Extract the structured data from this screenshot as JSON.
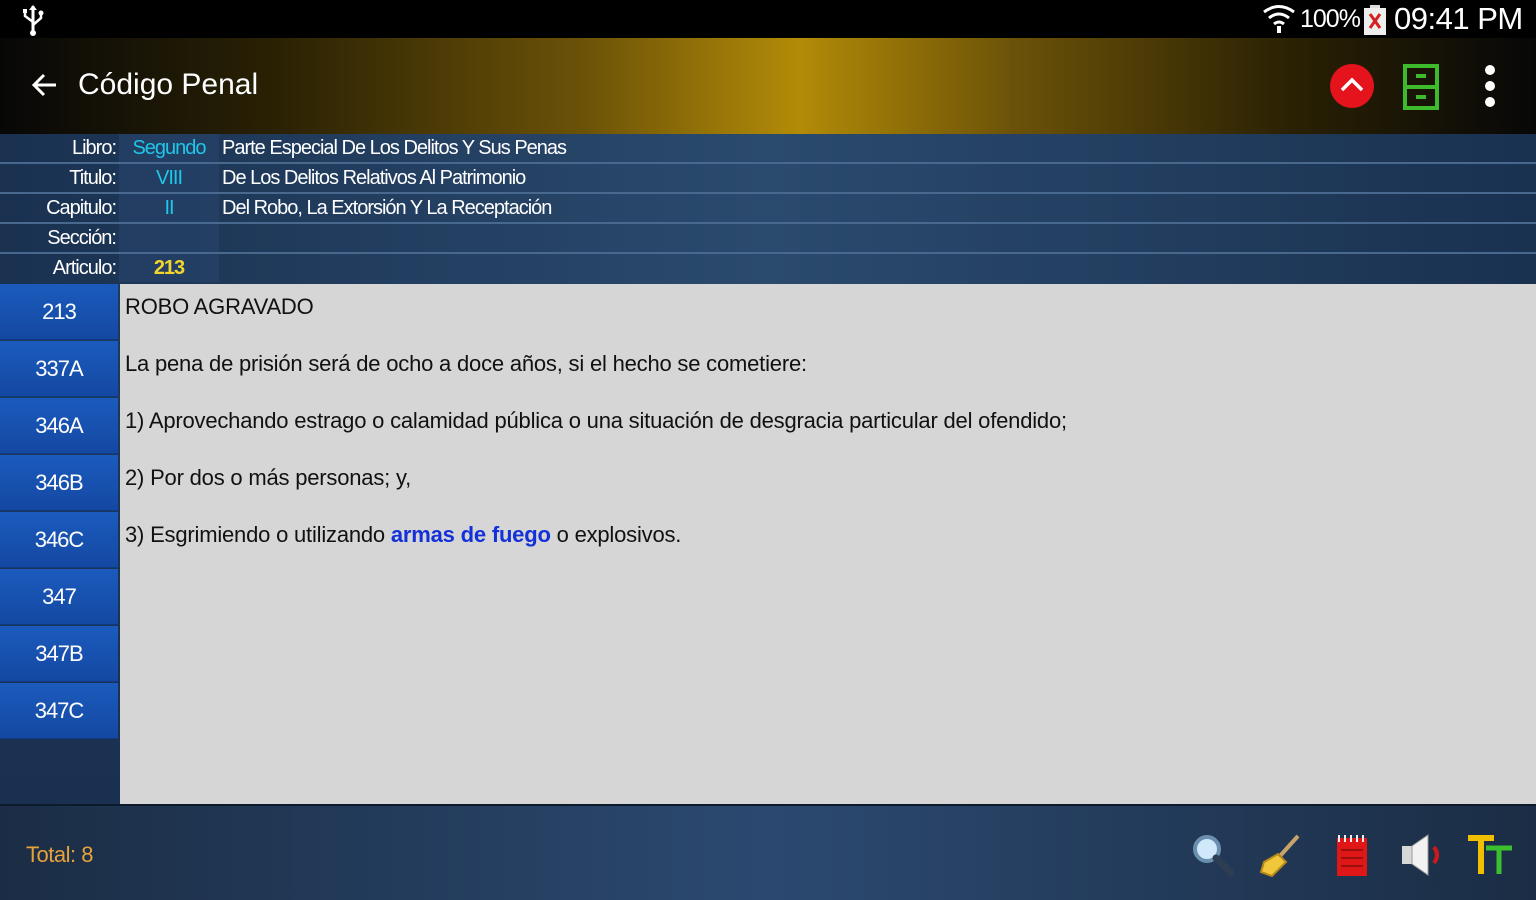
{
  "status_bar": {
    "battery_percent": "100%",
    "time": "09:41 PM",
    "icons": [
      "usb-icon",
      "wifi-icon",
      "battery-icon"
    ]
  },
  "app_bar": {
    "title": "Código Penal",
    "icons": [
      "back-arrow-icon",
      "chevron-up-icon",
      "file-cabinet-icon",
      "more-vert-icon"
    ]
  },
  "info": {
    "libro": {
      "label": "Libro:",
      "value": "Segundo",
      "desc": "Parte Especial De Los Delitos Y Sus Penas"
    },
    "titulo": {
      "label": "Titulo:",
      "value": "VIII",
      "desc": "De Los Delitos Relativos Al Patrimonio"
    },
    "capitulo": {
      "label": "Capitulo:",
      "value": "II",
      "desc": "Del Robo, La Extorsión Y La Receptación"
    },
    "seccion": {
      "label": "Sección:",
      "value": "",
      "desc": ""
    },
    "articulo": {
      "label": "Articulo:",
      "value": "213",
      "desc": ""
    }
  },
  "sidebar": {
    "items": [
      "213",
      "337A",
      "346A",
      "346B",
      "346C",
      "347",
      "347B",
      "347C"
    ]
  },
  "content": {
    "heading": "ROBO AGRAVADO",
    "paragraph1": "La pena de prisión será de ocho a doce años, si el hecho se cometiere:",
    "item1": "1) Aprovechando estrago o calamidad pública o una situación de desgracia particular del ofendido;",
    "item2": "2) Por dos o más personas; y,",
    "item3_before": "3) Esgrimiendo o utilizando ",
    "item3_link": "armas de fuego",
    "item3_after": " o explosivos."
  },
  "bottom_bar": {
    "total": "Total: 8",
    "tools": [
      "search-icon",
      "broom-icon",
      "notepad-icon",
      "speaker-icon",
      "text-size-icon"
    ]
  },
  "colors": {
    "accent_gold": "#b38b08",
    "up_button_red": "#e5131b",
    "cabinet_green": "#3dbb2d",
    "list_blue": "#1b5bbd",
    "link_blue": "#1330d9",
    "value_cyan": "#1ec6e8",
    "article_yellow": "#f3d52c",
    "total_orange": "#e7a23a"
  }
}
